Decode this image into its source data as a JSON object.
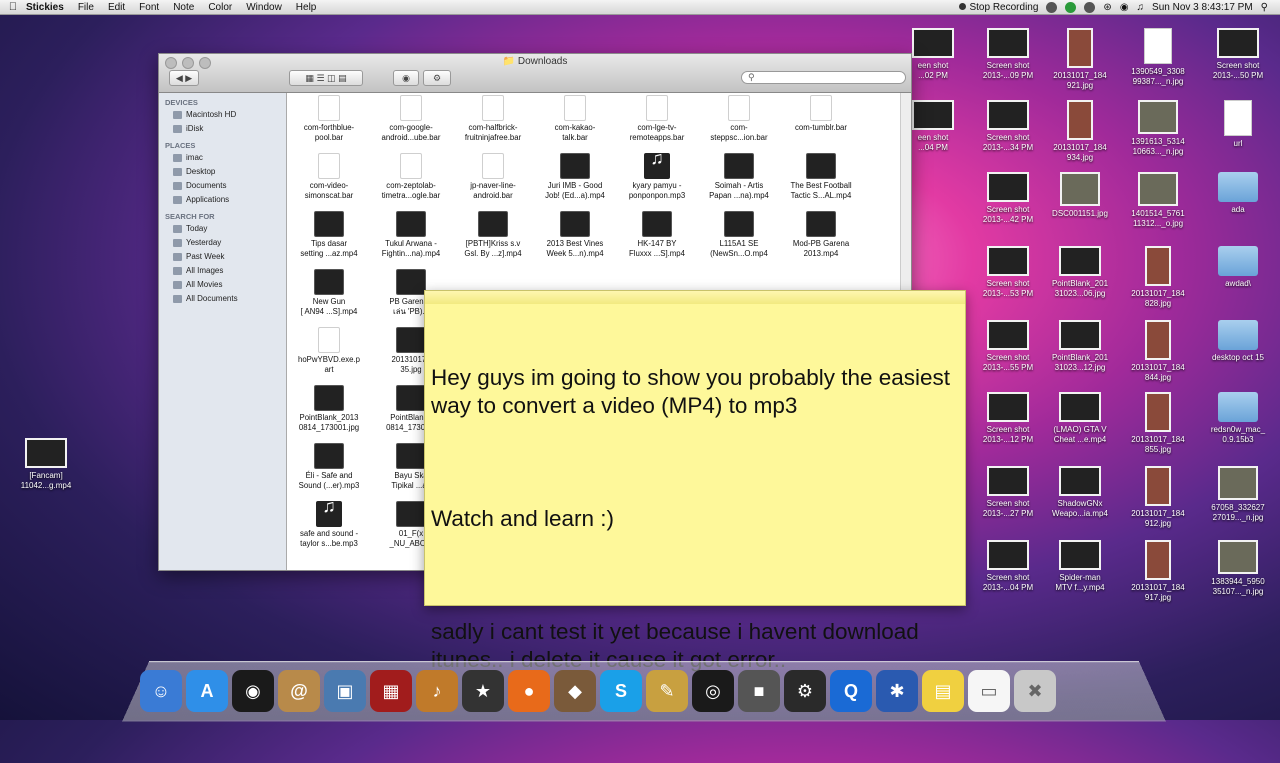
{
  "menubar": {
    "app": "Stickies",
    "menus": [
      "File",
      "Edit",
      "Font",
      "Note",
      "Color",
      "Window",
      "Help"
    ],
    "stop_recording": "Stop Recording",
    "clock": "Sun Nov 3   8:43:17 PM"
  },
  "finder": {
    "title": "Downloads",
    "sidebar": {
      "devices_header": "DEVICES",
      "devices": [
        "Macintosh HD",
        "iDisk"
      ],
      "places_header": "PLACES",
      "places": [
        "imac",
        "Desktop",
        "Documents",
        "Applications"
      ],
      "search_header": "SEARCH FOR",
      "search": [
        "Today",
        "Yesterday",
        "Past Week",
        "All Images",
        "All Movies",
        "All Documents"
      ]
    },
    "files": [
      {
        "name": "com-forthblue-\npool.bar",
        "kind": "doc"
      },
      {
        "name": "com-google-\nandroid...ube.bar",
        "kind": "doc"
      },
      {
        "name": "com-halfbrick-\nfruitninjafree.bar",
        "kind": "doc"
      },
      {
        "name": "com-kakao-\ntalk.bar",
        "kind": "doc"
      },
      {
        "name": "com-lge-tv-\nremoteapps.bar",
        "kind": "doc"
      },
      {
        "name": "com-\nsteppsc...ion.bar",
        "kind": "doc"
      },
      {
        "name": "com-tumblr.bar",
        "kind": "doc"
      },
      {
        "name": "com-video-\nsimonscat.bar",
        "kind": "doc"
      },
      {
        "name": "com-zeptolab-\ntimetra...ogle.bar",
        "kind": "doc"
      },
      {
        "name": "jp-naver-line-\nandroid.bar",
        "kind": "doc"
      },
      {
        "name": "Juri IMB - Good\nJob! (Ed...a).mp4",
        "kind": "vid"
      },
      {
        "name": "kyary pamyu -\nponponpon.mp3",
        "kind": "note"
      },
      {
        "name": "Soimah - Artis\nPapan ...na).mp4",
        "kind": "vid"
      },
      {
        "name": "The Best Football\nTactic S...AL.mp4",
        "kind": "vid"
      },
      {
        "name": "Tips dasar\nsetting ...az.mp4",
        "kind": "vid"
      },
      {
        "name": "Tukul Arwana -\nFightin...na).mp4",
        "kind": "vid"
      },
      {
        "name": "[PBTH]Kriss s.v\nGsl. By ...z].mp4",
        "kind": "vid"
      },
      {
        "name": "2013 Best Vines\nWeek 5...n).mp4",
        "kind": "vid"
      },
      {
        "name": "HK-147 BY\nFluxxx ...S].mp4",
        "kind": "vid"
      },
      {
        "name": "L115A1 SE\n(NewSn...O.mp4",
        "kind": "vid"
      },
      {
        "name": "Mod-PB Garena\n2013.mp4",
        "kind": "vid"
      },
      {
        "name": "New Gun\n[ AN94 ...S].mp4",
        "kind": "vid"
      },
      {
        "name": "PB Garena (\nเล่น 'PB)...",
        "kind": "vid"
      },
      {
        "name": "hoPwYBVD.exe.p\nart",
        "kind": "doc"
      },
      {
        "name": "20131017_\n35.jpg",
        "kind": "vid"
      },
      {
        "name": "PointBlank_2013\n0814_173001.jpg",
        "kind": "vid"
      },
      {
        "name": "PointBlank_\n0814_17300...",
        "kind": "vid"
      },
      {
        "name": "Éli - Safe and\nSound (...er).mp3",
        "kind": "vid"
      },
      {
        "name": "Bayu Ska\nTipikal ...ak",
        "kind": "vid"
      },
      {
        "name": "safe and sound -\ntaylor s...be.mp3",
        "kind": "note"
      },
      {
        "name": "01_F(x\n_NU_ABO...",
        "kind": "vid"
      }
    ]
  },
  "sticky": {
    "lines": [
      "Hey guys im going to show you probably the easiest way to convert a video (MP4) to mp3",
      "Watch and learn :)",
      "sadly i cant test it yet because i havent download itunes.. i delete it cause it got error.."
    ]
  },
  "desktop": {
    "left_icon": "[Fancam]\n11042...g.mp4",
    "icons": [
      "een shot\n...02 PM",
      "Screen shot\n2013-...09 PM",
      "20131017_184\n921.jpg",
      "1390549_3308\n99387..._n.jpg",
      "Screen shot\n2013-...50 PM",
      "een shot\n...04 PM",
      "Screen shot\n2013-...34 PM",
      "20131017_184\n934.jpg",
      "1391613_5314\n10663..._n.jpg",
      "url",
      "Screen shot\n2013-...42 PM",
      "DSC001151.jpg",
      "1401514_5761\n11312..._o.jpg",
      "ada",
      "Screen shot\n2013-...53 PM",
      "PointBlank_201\n31023...06.jpg",
      "20131017_184\n828.jpg",
      "awdad\\",
      "Screen shot\n2013-...55 PM",
      "PointBlank_201\n31023...12.jpg",
      "20131017_184\n844.jpg",
      "desktop oct 15",
      "Screen shot\n2013-...12 PM",
      "(LMAO) GTA V\nCheat ...e.mp4",
      "20131017_184\n855.jpg",
      "redsn0w_mac_\n0.9.15b3",
      "Screen shot\n2013-...27 PM",
      "ShadowGNx\nWeapo...ia.mp4",
      "20131017_184\n912.jpg",
      "67058_332627\n27019..._n.jpg",
      "Screen shot\n2013-...04 PM",
      "Spider-man\nMTV f...y.mp4",
      "20131017_184\n917.jpg",
      "1383944_5950\n35107..._n.jpg"
    ]
  },
  "dock": [
    "finder-icon",
    "app-store-icon",
    "facetime-icon",
    "address-book-icon",
    "iphoto-icon",
    "photo-booth-icon",
    "garageband-icon",
    "imovie-icon",
    "firefox-icon",
    "dog-app-icon",
    "skype-icon",
    "pencils-icon",
    "steering-wheel-icon",
    "game-app-icon",
    "steam-icon",
    "quicktime-icon",
    "bluetooth-icon",
    "stickies-icon",
    "document-icon",
    "trash-icon"
  ]
}
